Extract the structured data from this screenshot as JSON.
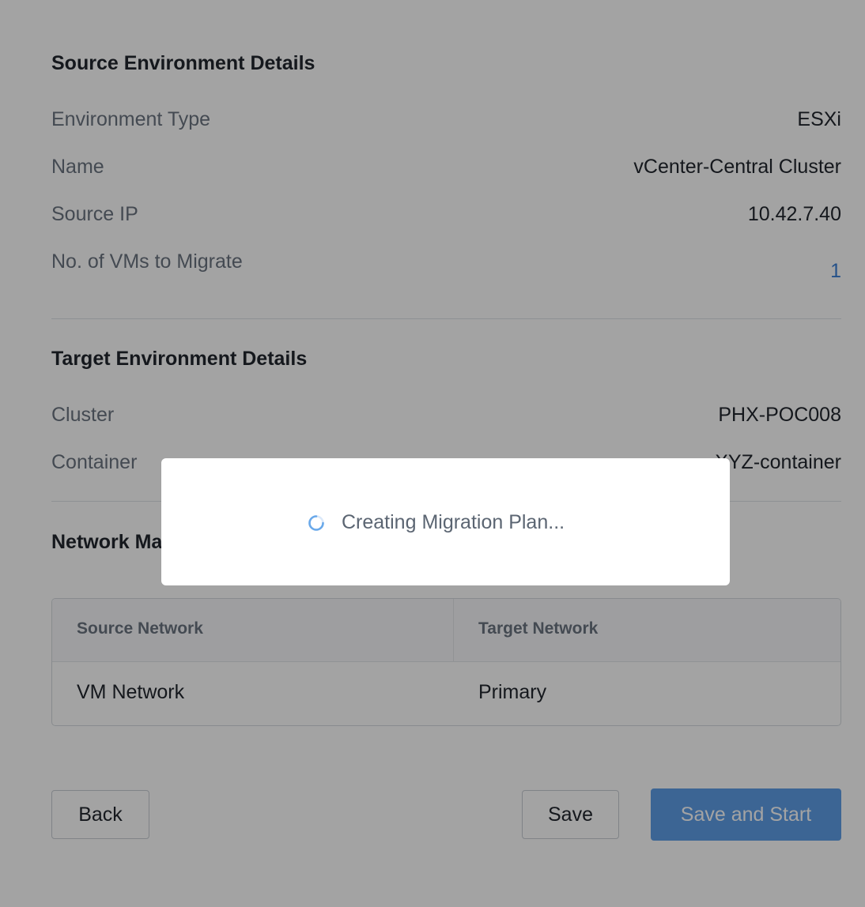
{
  "source_section": {
    "title": "Source Environment Details",
    "rows": [
      {
        "label": "Environment Type",
        "value": "ESXi"
      },
      {
        "label": "Name",
        "value": "vCenter-Central Cluster"
      },
      {
        "label": "Source IP",
        "value": "10.42.7.40"
      },
      {
        "label": "No. of VMs to Migrate",
        "value": "1"
      }
    ]
  },
  "target_section": {
    "title": "Target Environment Details",
    "rows": [
      {
        "label": "Cluster",
        "value": "PHX-POC008"
      },
      {
        "label": "Container",
        "value": "XYZ-container"
      }
    ]
  },
  "network_section": {
    "title": "Network Mapping",
    "columns": [
      "Source Network",
      "Target Network"
    ],
    "rows": [
      {
        "source": "VM Network",
        "target": "Primary"
      }
    ]
  },
  "buttons": {
    "back": "Back",
    "save": "Save",
    "save_and_start": "Save and Start"
  },
  "loading_modal": {
    "message": "Creating Migration Plan...",
    "icon": "spinner-icon"
  },
  "colors": {
    "overlay": "rgba(0,0,0,0.36)",
    "primary_button": "#5f9fe8",
    "link_value": "#3a7fd6",
    "spinner": "#6aa9ea"
  }
}
